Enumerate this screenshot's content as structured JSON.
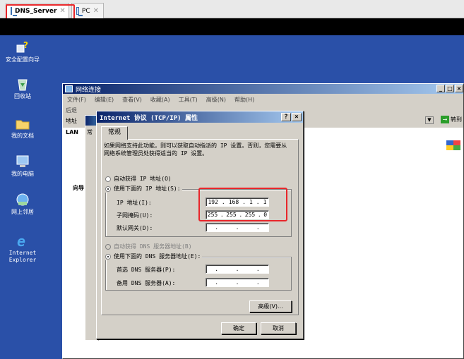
{
  "host_tabs": [
    {
      "label": "DNS_Server",
      "close": "✕"
    },
    {
      "label": "PC",
      "close": "✕"
    }
  ],
  "desktop": {
    "icons": [
      {
        "label": "安全配置向导"
      },
      {
        "label": "回收站"
      },
      {
        "label": "我的文档"
      },
      {
        "label": "我的电脑"
      },
      {
        "label": "网上邻居"
      },
      {
        "label": "Internet Explorer"
      }
    ]
  },
  "network_window": {
    "title": "网络连接",
    "menu": [
      "文件(F)",
      "编辑(E)",
      "查看(V)",
      "收藏(A)",
      "工具(T)",
      "高级(N)",
      "帮助(H)"
    ],
    "toolbar_text": "后退",
    "address_label": "地址",
    "goto_label": "转到",
    "lan_label": "LAN",
    "wizard_label": "向导",
    "buttons": {
      "min": "_",
      "max": "□",
      "close": "×"
    }
  },
  "behind_dialog": {
    "tab": "常"
  },
  "tcpip_dialog": {
    "title": "Internet 协议 (TCP/IP) 属性",
    "help_btn": "?",
    "close_btn": "×",
    "tab": "常规",
    "description": "如果网络支持此功能，则可以获取自动指派的 IP 设置。否则，您需要从网络系统管理员处获得适当的 IP 设置。",
    "auto_ip": "自动获得 IP 地址(O)",
    "manual_ip": "使用下面的 IP 地址(S):",
    "ip_label": "IP 地址(I):",
    "ip_address": [
      "192",
      "168",
      "1",
      "1"
    ],
    "mask_label": "子网掩码(U):",
    "subnet_mask": [
      "255",
      "255",
      "255",
      "0"
    ],
    "gateway_label": "默认网关(D):",
    "auto_dns": "自动获得 DNS 服务器地址(B)",
    "manual_dns": "使用下面的 DNS 服务器地址(E):",
    "preferred_dns_label": "首选 DNS 服务器(P):",
    "alternate_dns_label": "备用 DNS 服务器(A):",
    "advanced_btn": "高级(V)...",
    "ok_btn": "确定",
    "cancel_btn": "取消"
  },
  "colors": {
    "highlight": "#e8262a",
    "desktop": "#2a50a8",
    "titlebar": "#0a246a"
  }
}
